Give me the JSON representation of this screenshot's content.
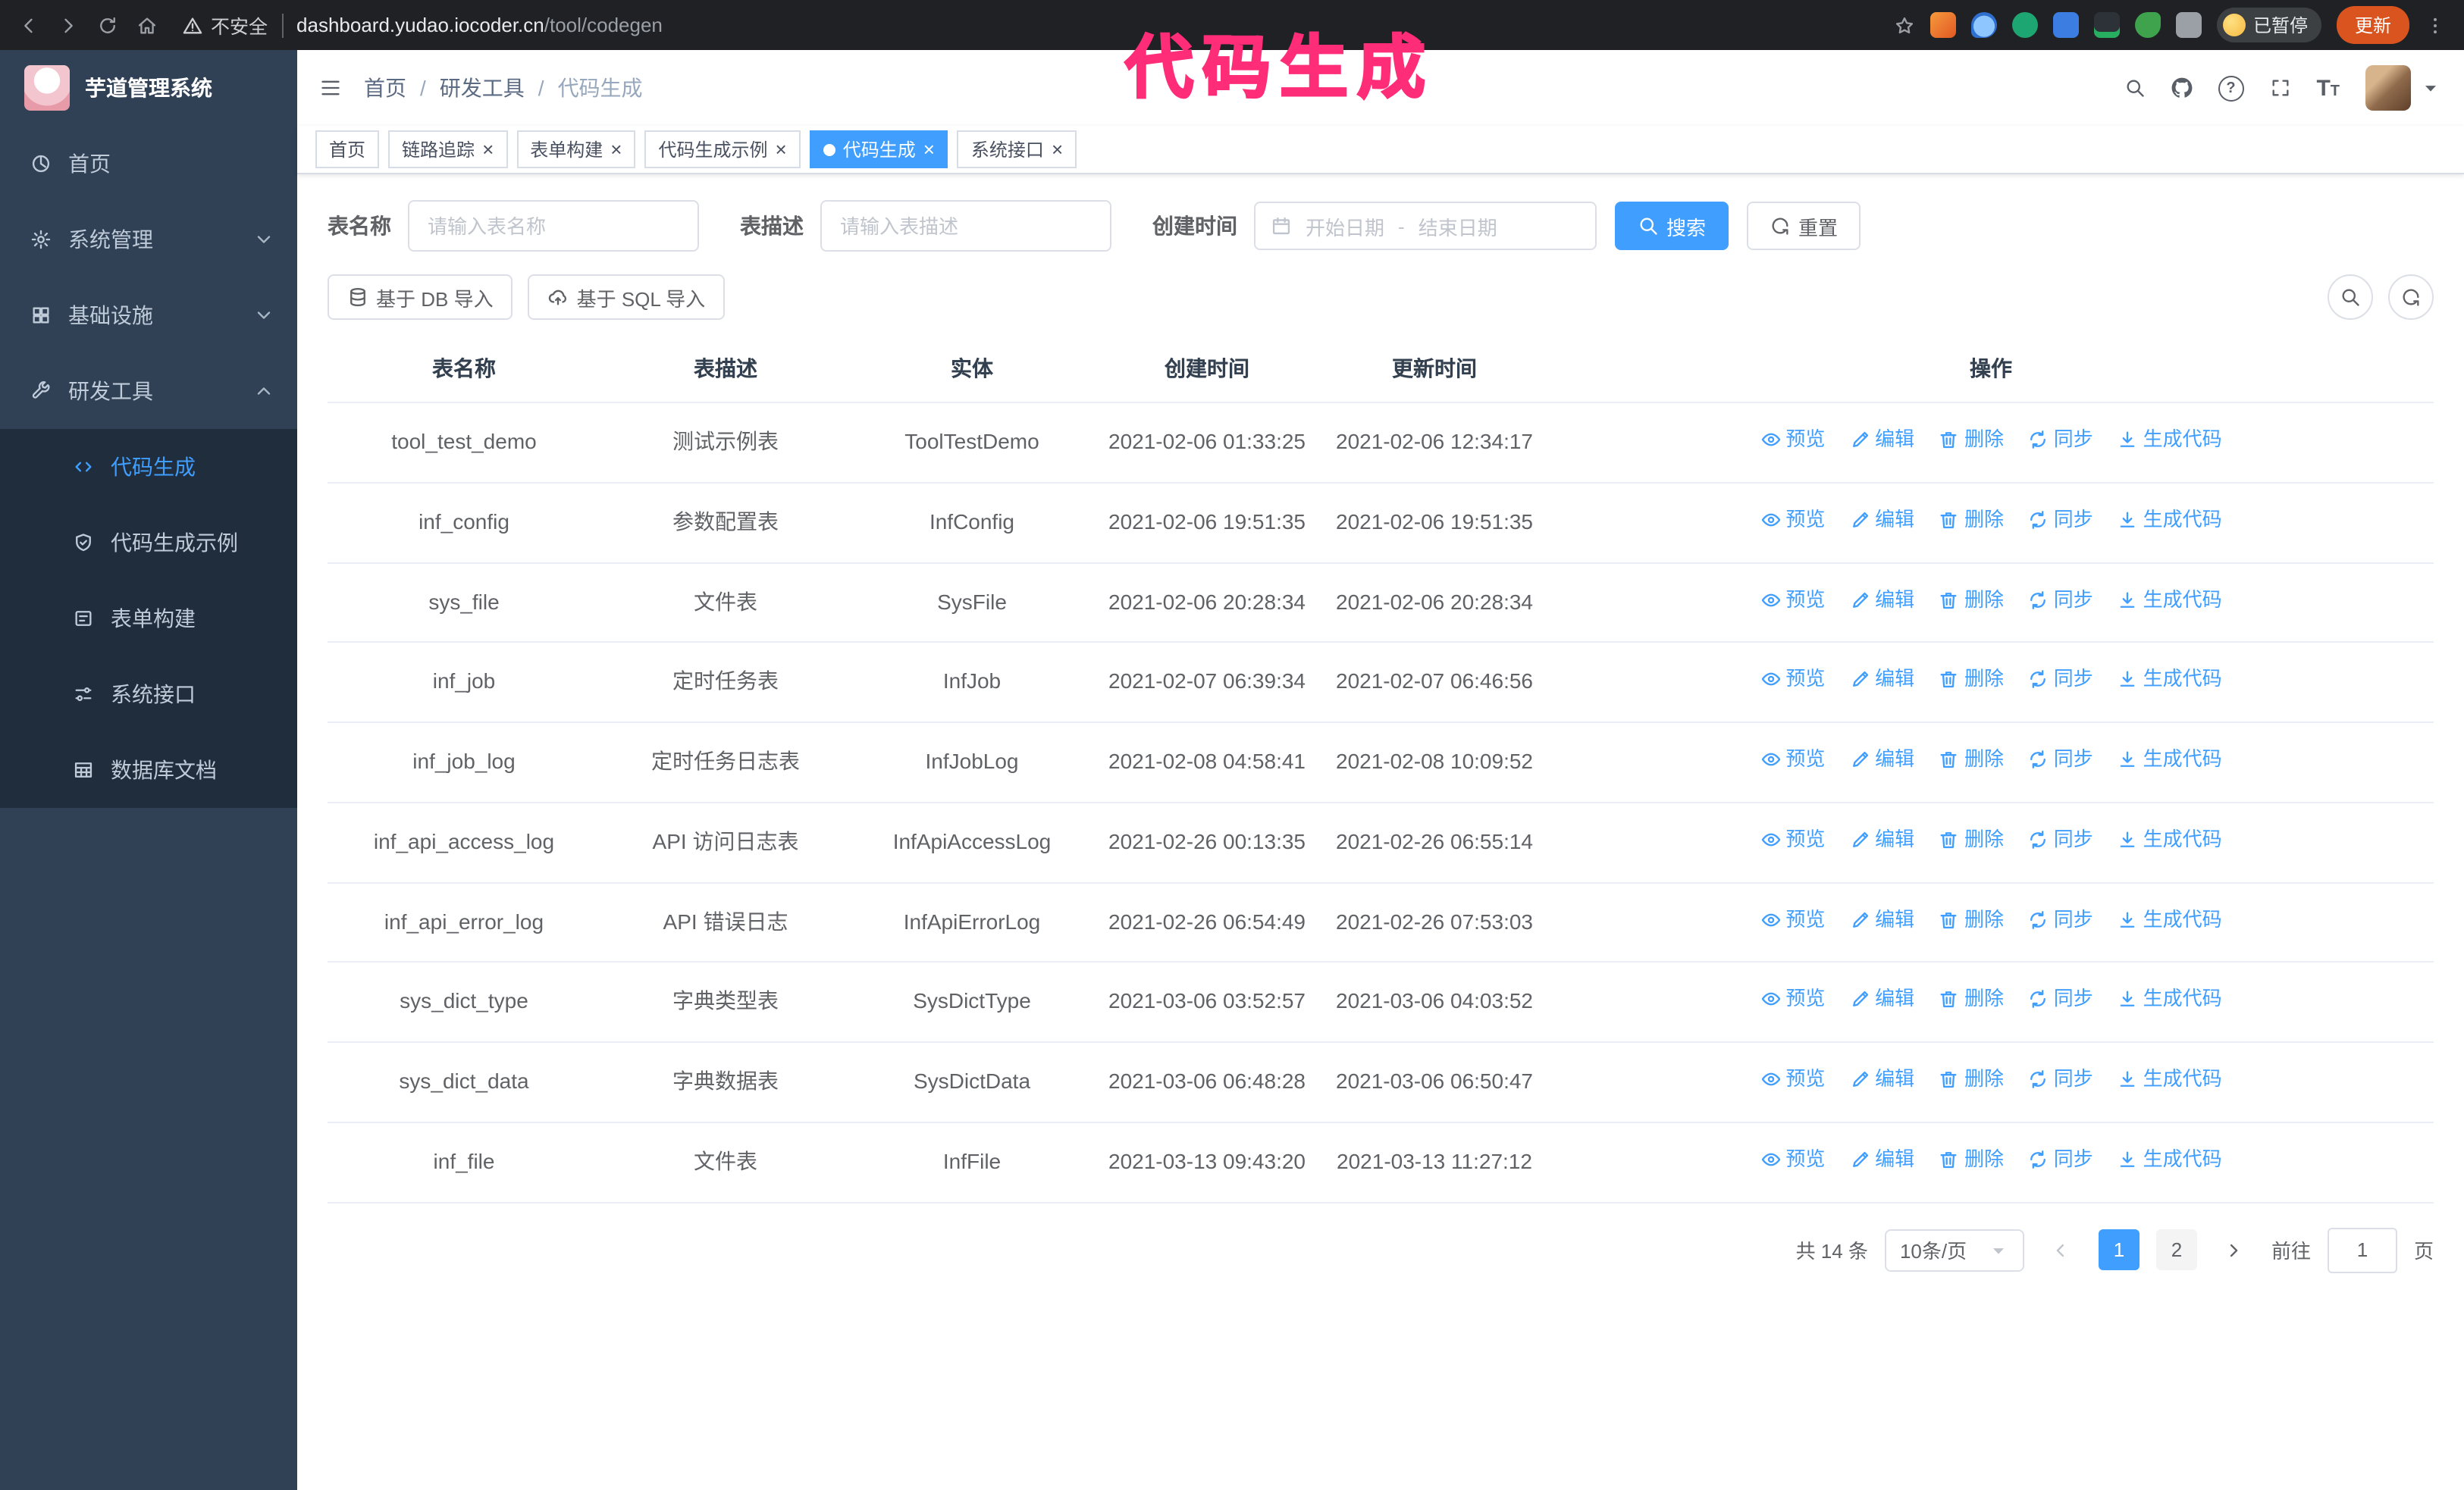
{
  "annotation": {
    "text": "代码生成"
  },
  "colors": {
    "primary": "#409EFF",
    "annotation": "#ff2d78",
    "sidebar_bg": "#304156",
    "submenu_bg": "#1f2d3d",
    "update_button": "#d9541e"
  },
  "browser": {
    "security": "不安全",
    "url_host": "dashboard.yudao.iocoder.cn",
    "url_path": "/tool/codegen",
    "paused_label": "已暂停",
    "update_label": "更新"
  },
  "icons": {
    "close": "×"
  },
  "sidebar": {
    "logo_title": "芋道管理系统",
    "items": [
      {
        "label": "首页"
      },
      {
        "label": "系统管理"
      },
      {
        "label": "基础设施"
      },
      {
        "label": "研发工具"
      }
    ],
    "submenu": [
      {
        "label": "代码生成"
      },
      {
        "label": "代码生成示例"
      },
      {
        "label": "表单构建"
      },
      {
        "label": "系统接口"
      },
      {
        "label": "数据库文档"
      }
    ]
  },
  "navbar": {
    "breadcrumb": [
      "首页",
      "研发工具",
      "代码生成"
    ],
    "separator": "/",
    "font_icon_big": "T",
    "font_icon_small": "T",
    "question_mark": "?"
  },
  "tabs": [
    {
      "label": "首页"
    },
    {
      "label": "链路追踪"
    },
    {
      "label": "表单构建"
    },
    {
      "label": "代码生成示例"
    },
    {
      "label": "代码生成"
    },
    {
      "label": "系统接口"
    }
  ],
  "filters": {
    "name_label": "表名称",
    "name_placeholder": "请输入表名称",
    "desc_label": "表描述",
    "desc_placeholder": "请输入表描述",
    "time_label": "创建时间",
    "start_placeholder": "开始日期",
    "range_separator": "-",
    "end_placeholder": "结束日期",
    "search_label": "搜索",
    "reset_label": "重置"
  },
  "toolbar": {
    "import_db_label": "基于 DB 导入",
    "import_sql_label": "基于 SQL 导入"
  },
  "table": {
    "columns": [
      "表名称",
      "表描述",
      "实体",
      "创建时间",
      "更新时间",
      "操作"
    ],
    "actions": [
      "预览",
      "编辑",
      "删除",
      "同步",
      "生成代码"
    ],
    "rows": [
      {
        "name": "tool_test_demo",
        "desc": "测试示例表",
        "entity": "ToolTestDemo",
        "created": "2021-02-06 01:33:25",
        "updated": "2021-02-06 12:34:17"
      },
      {
        "name": "inf_config",
        "desc": "参数配置表",
        "entity": "InfConfig",
        "created": "2021-02-06 19:51:35",
        "updated": "2021-02-06 19:51:35"
      },
      {
        "name": "sys_file",
        "desc": "文件表",
        "entity": "SysFile",
        "created": "2021-02-06 20:28:34",
        "updated": "2021-02-06 20:28:34"
      },
      {
        "name": "inf_job",
        "desc": "定时任务表",
        "entity": "InfJob",
        "created": "2021-02-07 06:39:34",
        "updated": "2021-02-07 06:46:56"
      },
      {
        "name": "inf_job_log",
        "desc": "定时任务日志表",
        "entity": "InfJobLog",
        "created": "2021-02-08 04:58:41",
        "updated": "2021-02-08 10:09:52"
      },
      {
        "name": "inf_api_access_log",
        "desc": "API 访问日志表",
        "entity": "InfApiAccessLog",
        "created": "2021-02-26 00:13:35",
        "updated": "2021-02-26 06:55:14"
      },
      {
        "name": "inf_api_error_log",
        "desc": "API 错误日志",
        "entity": "InfApiErrorLog",
        "created": "2021-02-26 06:54:49",
        "updated": "2021-02-26 07:53:03"
      },
      {
        "name": "sys_dict_type",
        "desc": "字典类型表",
        "entity": "SysDictType",
        "created": "2021-03-06 03:52:57",
        "updated": "2021-03-06 04:03:52"
      },
      {
        "name": "sys_dict_data",
        "desc": "字典数据表",
        "entity": "SysDictData",
        "created": "2021-03-06 06:48:28",
        "updated": "2021-03-06 06:50:47"
      },
      {
        "name": "inf_file",
        "desc": "文件表",
        "entity": "InfFile",
        "created": "2021-03-13 09:43:20",
        "updated": "2021-03-13 11:27:12"
      }
    ]
  },
  "pagination": {
    "total": "共 14 条",
    "page_size": "10条/页",
    "pages": [
      "1",
      "2"
    ],
    "goto_label": "前往",
    "goto_value": "1",
    "goto_suffix": "页"
  }
}
